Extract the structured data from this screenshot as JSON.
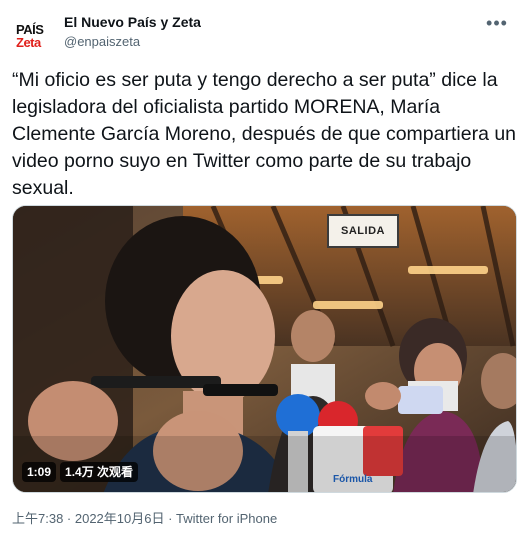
{
  "tweet": {
    "avatar": {
      "line1": "PAÍS",
      "line2": "Zeta"
    },
    "author_name": "El Nuevo País y Zeta",
    "author_handle": "@enpaiszeta",
    "more_icon": "more-horizontal-icon",
    "text": "“Mi oficio es ser puta y tengo derecho a ser puta” dice la legisladora del oficialista partido MORENA, María Clemente García Moreno, después de que compartiera un video porno suyo en Twitter como parte de su trabajo sexual.",
    "media": {
      "sign_text": "SALIDA",
      "mic_label": "Fórmula",
      "duration": "1:09",
      "views": "1.4万 次观看"
    },
    "timestamp": "上午7:38 · 2022年10月6日",
    "separator": " · ",
    "client": "Twitter for iPhone"
  },
  "colors": {
    "text_primary": "#0f1419",
    "text_secondary": "#536471",
    "border": "#cfd9de",
    "brand_red": "#e0201b"
  }
}
